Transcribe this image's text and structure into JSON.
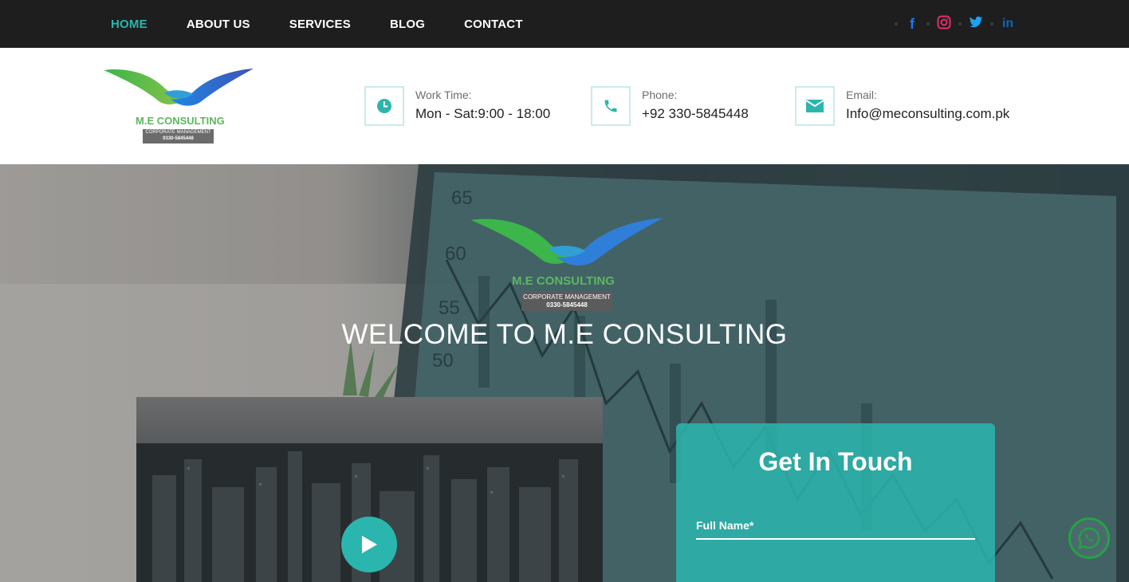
{
  "nav": {
    "items": [
      {
        "label": "HOME",
        "active": true
      },
      {
        "label": "ABOUT US"
      },
      {
        "label": "SERVICES"
      },
      {
        "label": "BLOG"
      },
      {
        "label": "CONTACT"
      }
    ],
    "social": [
      {
        "icon": "facebook-icon",
        "glyph": "f",
        "color": "#1877f2"
      },
      {
        "icon": "instagram-icon",
        "glyph": "◎",
        "color": "#e1306c"
      },
      {
        "icon": "twitter-icon",
        "glyph": "🐦",
        "color": "#1da1f2"
      },
      {
        "icon": "linkedin-icon",
        "glyph": "in",
        "color": "#0a66c2"
      }
    ]
  },
  "logo": {
    "name": "M.E CONSULTING",
    "tagline": "CORPORATE MANAGEMENT",
    "phone": "0330-5845448"
  },
  "header_info": {
    "work": {
      "label": "Work Time:",
      "value": "Mon - Sat:9:00 - 18:00",
      "icon": "clock-icon"
    },
    "phone": {
      "label": "Phone:",
      "value": "+92 330-5845448",
      "icon": "phone-icon"
    },
    "email": {
      "label": "Email:",
      "value": "Info@meconsulting.com.pk",
      "icon": "envelope-icon"
    }
  },
  "hero": {
    "welcome": "WELCOME TO M.E CONSULTING"
  },
  "contact_form": {
    "title": "Get In Touch",
    "full_name_label": "Full Name*"
  },
  "colors": {
    "accent": "#2ab6ae",
    "logo_green": "#5cb85c",
    "topbar": "#1e1e1e",
    "whatsapp": "#25a244"
  }
}
